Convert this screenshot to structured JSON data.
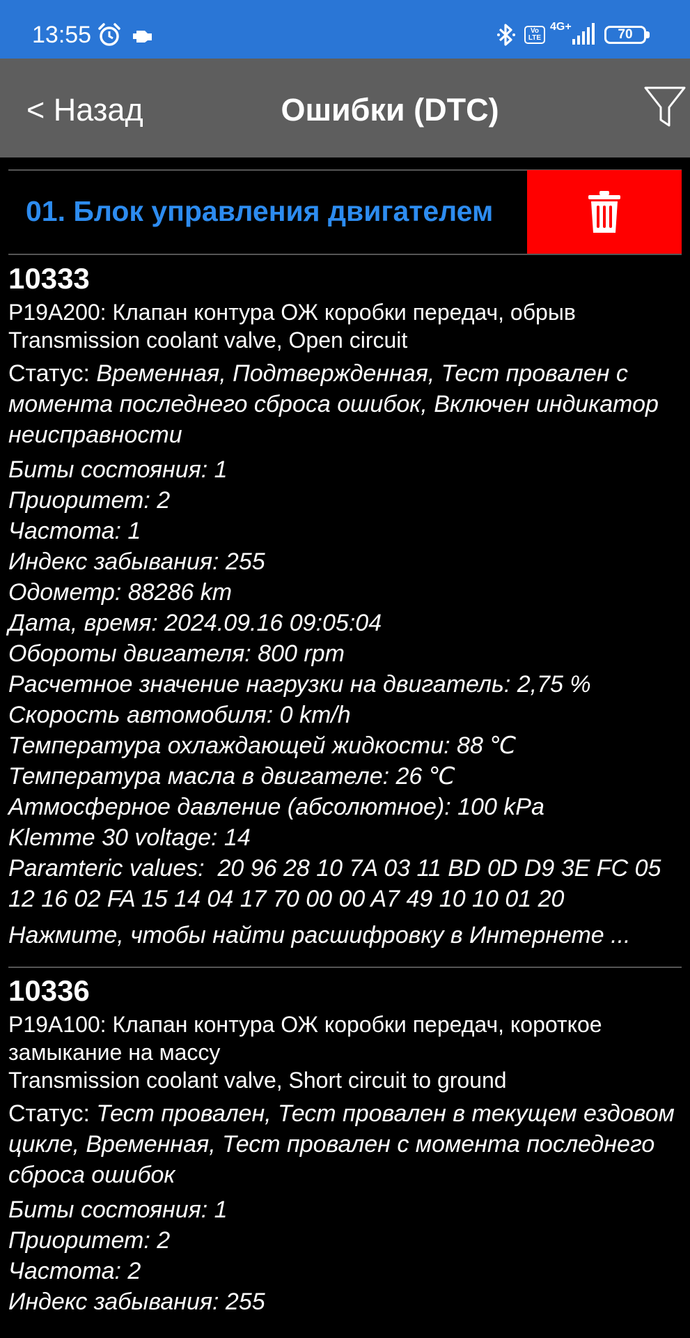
{
  "status_bar": {
    "time": "13:55",
    "battery": "70",
    "network": "4G+",
    "volte": "Vo LTE"
  },
  "app_bar": {
    "back_label": "< Назад",
    "title": "Ошибки (DTC)"
  },
  "ecu": {
    "title": "01. Блок управления двигателем"
  },
  "dtcs": [
    {
      "code": "10333",
      "desc_ru": "P19A200: Клапан контура ОЖ коробки передач, обрыв",
      "desc_en": "Transmission coolant valve, Open circuit",
      "status_label": "Статус: ",
      "status_value": "Временная, Подтвержденная, Тест провален с момента последнего сброса ошибок, Включен индикатор неисправности",
      "params": [
        "Биты состояния: 1",
        "Приоритет: 2",
        "Частота: 1",
        "Индекс забывания: 255",
        "Одометр: 88286 km",
        "Дата, время: 2024.09.16 09:05:04",
        "Обороты двигателя: 800 rpm",
        "Расчетное значение нагрузки на двигатель: 2,75 %",
        "Скорость автомобиля: 0 km/h",
        "Температура охлаждающей жидкости: 88 ℃",
        "Температура масла в двигателе: 26 ℃",
        "Атмосферное давление (абсолютное): 100 kPa",
        "Klemme 30 voltage: 14",
        "Paramteric values:  20 96 28 10 7A 03 11 BD 0D D9 3E FC 05 12 16 02 FA 15 14 04 17 70 00 00 A7 49 10 10 01 20"
      ],
      "hint": "Нажмите, чтобы найти расшифровку в Интернете ..."
    },
    {
      "code": "10336",
      "desc_ru": "P19A100: Клапан контура ОЖ коробки передач, короткое замыкание на массу",
      "desc_en": "Transmission coolant valve, Short circuit to ground",
      "status_label": "Статус: ",
      "status_value": "Тест провален, Тест провален в текущем ездовом цикле, Временная, Тест провален с момента последнего сброса ошибок",
      "params": [
        "Биты состояния: 1",
        "Приоритет: 2",
        "Частота: 2",
        "Индекс забывания: 255"
      ]
    }
  ]
}
